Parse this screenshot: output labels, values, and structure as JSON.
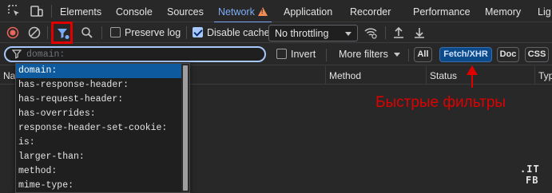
{
  "tabs": [
    {
      "label": "Elements",
      "active": false
    },
    {
      "label": "Console",
      "active": false
    },
    {
      "label": "Sources",
      "active": false
    },
    {
      "label": "Network",
      "active": true,
      "warning": true
    },
    {
      "label": "Application",
      "active": false
    },
    {
      "label": "Recorder",
      "active": false
    },
    {
      "label": "Performance",
      "active": false
    },
    {
      "label": "Memory",
      "active": false
    },
    {
      "label": "Lig",
      "active": false
    }
  ],
  "toolbar": {
    "preserve_log": {
      "label": "Preserve log",
      "checked": false
    },
    "disable_cache": {
      "label": "Disable cache",
      "checked": true
    },
    "throttling": {
      "selected": "No throttling"
    }
  },
  "filter": {
    "placeholder": "domain:",
    "invert_label": "Invert",
    "more_filters_label": "More filters",
    "type_buttons": [
      {
        "label": "All",
        "active": false
      },
      {
        "label": "Fetch/XHR",
        "active": true
      },
      {
        "label": "Doc",
        "active": false
      },
      {
        "label": "CSS",
        "active": false
      }
    ]
  },
  "table": {
    "columns": [
      "Na",
      "Method",
      "Status",
      "Typ"
    ]
  },
  "autocomplete": {
    "items": [
      {
        "label": "domain:",
        "selected": true
      },
      {
        "label": "has-response-header:",
        "selected": false
      },
      {
        "label": "has-request-header:",
        "selected": false
      },
      {
        "label": "has-overrides:",
        "selected": false
      },
      {
        "label": "response-header-set-cookie:",
        "selected": false
      },
      {
        "label": "is:",
        "selected": false
      },
      {
        "label": "larger-than:",
        "selected": false
      },
      {
        "label": "method:",
        "selected": false
      },
      {
        "label": "mime-type:",
        "selected": false
      }
    ]
  },
  "annotation": {
    "text": "Быстрые фильтры",
    "color": "#e00000"
  },
  "watermark": {
    "line1": ".IT",
    "line2": "FB"
  },
  "colors": {
    "accent": "#7cacf8",
    "background": "#282828",
    "warning": "#f28b54"
  }
}
